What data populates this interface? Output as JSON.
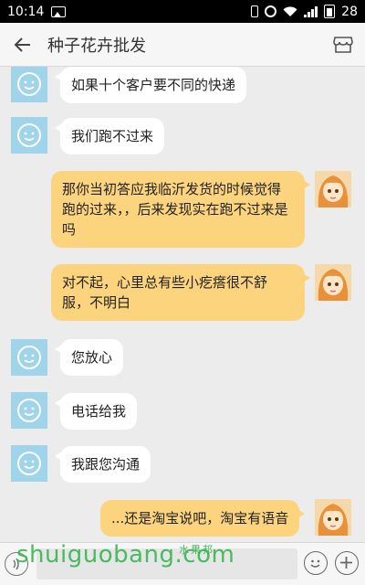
{
  "status_bar": {
    "time": "10:14",
    "battery": "28"
  },
  "header": {
    "title": "种子花卉批发"
  },
  "messages": [
    {
      "side": "in",
      "text": "如果十个客户要不同的快递"
    },
    {
      "side": "in",
      "text": "我们跑不过来"
    },
    {
      "side": "out",
      "text": "那你当初答应我临沂发货的时候觉得跑的过来，，后来发现实在跑不过来是吗"
    },
    {
      "side": "out",
      "text": "对不起，心里总有些小疙瘩很不舒服，不明白"
    },
    {
      "side": "in",
      "text": "您放心"
    },
    {
      "side": "in",
      "text": "电话给我"
    },
    {
      "side": "in",
      "text": "我跟您沟通"
    },
    {
      "side": "out",
      "text": "...还是淘宝说吧，淘宝有语音"
    }
  ],
  "input_bar": {
    "placeholder": ""
  },
  "watermark": {
    "text": "shuiguobang.com",
    "cn_text": "水果邦"
  },
  "colors": {
    "incoming_bubble": "#ffffff",
    "outgoing_bubble": "#fcd47e",
    "avatar_left": "#9fd4ea",
    "background": "#ececec"
  },
  "icons": {
    "back": "arrow-left-icon",
    "shop": "store-icon",
    "voice": "voice-icon",
    "emoji": "smiley-icon",
    "plus": "plus-icon"
  }
}
